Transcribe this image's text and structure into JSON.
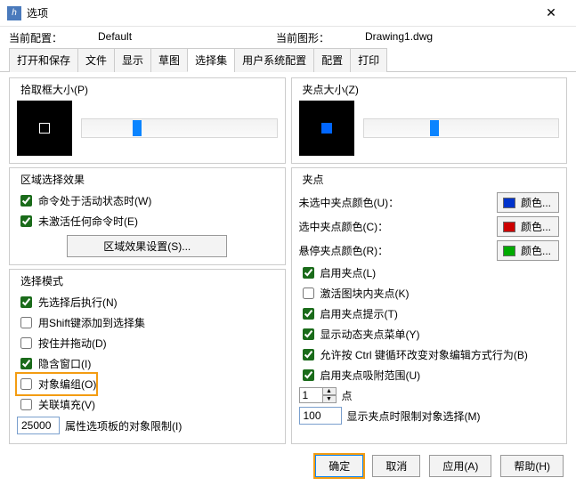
{
  "window": {
    "title": "选项",
    "close_glyph": "✕",
    "app_icon_text": "h"
  },
  "info": {
    "profile_label": "当前配置：",
    "profile_value": "Default",
    "drawing_label": "当前图形：",
    "drawing_value": "Drawing1.dwg"
  },
  "tabs": [
    "打开和保存",
    "文件",
    "显示",
    "草图",
    "选择集",
    "用户系统配置",
    "配置",
    "打印"
  ],
  "active_tab_index": 4,
  "left": {
    "pickbox": {
      "title": "拾取框大小(P)"
    },
    "region": {
      "title": "区域选择效果",
      "chk_active": "命令处于活动状态时(W)",
      "chk_idle": "未激活任何命令时(E)",
      "btn_settings": "区域效果设置(S)..."
    },
    "mode": {
      "title": "选择模式",
      "opt_nounverb": "先选择后执行(N)",
      "opt_shift": "用Shift键添加到选择集",
      "opt_pressdrag": "按住并拖动(D)",
      "opt_implied": "隐含窗口(I)",
      "opt_group": "对象编组(O)",
      "opt_hatch": "关联填充(V)",
      "limit_value": "25000",
      "limit_label": "属性选项板的对象限制(I)"
    }
  },
  "right": {
    "gripsize": {
      "title": "夹点大小(Z)"
    },
    "grips": {
      "title": "夹点",
      "unsel_label": "未选中夹点颜色(U)：",
      "sel_label": "选中夹点颜色(C)：",
      "hover_label": "悬停夹点颜色(R)：",
      "color_text": "颜色...",
      "swatches": {
        "unsel": "#0033cc",
        "sel": "#cc0000",
        "hover": "#00aa00"
      },
      "chk_enable": "启用夹点(L)",
      "chk_block": "激活图块内夹点(K)",
      "chk_tips": "启用夹点提示(T)",
      "chk_dynmenu": "显示动态夹点菜单(Y)",
      "chk_ctrl": "允许按 Ctrl 键循环改变对象编辑方式行为(B)",
      "chk_snaprange": "启用夹点吸附范围(U)",
      "spinner_value": "1",
      "spinner_suffix": "点",
      "threshold_value": "100",
      "threshold_label": "显示夹点时限制对象选择(M)"
    }
  },
  "footer": {
    "ok": "确定",
    "cancel": "取消",
    "apply": "应用(A)",
    "help": "帮助(H)"
  }
}
